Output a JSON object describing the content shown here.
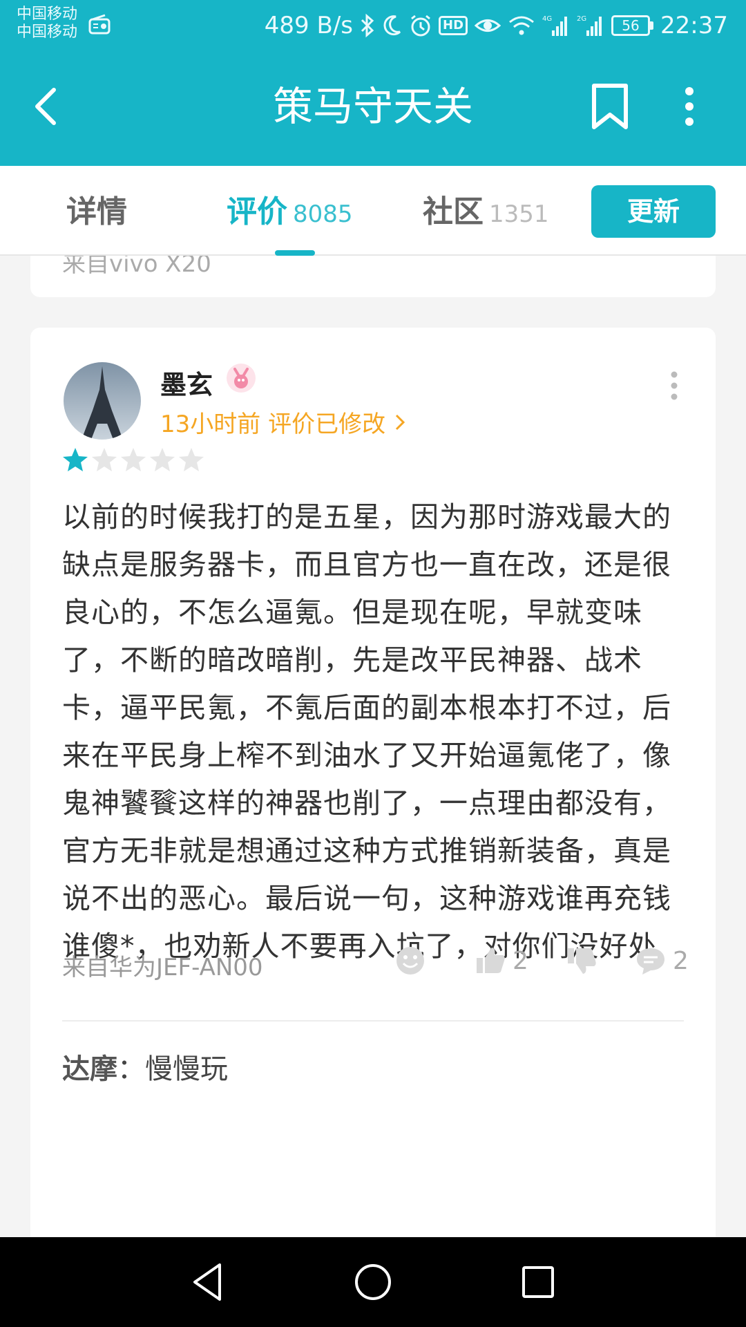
{
  "status_bar": {
    "carrier_1": "中国移动",
    "carrier_2": "中国移动",
    "speed": "489 B/s",
    "battery": "56",
    "time": "22:37"
  },
  "header": {
    "title": "策马守天关"
  },
  "tabs": [
    {
      "label": "详情",
      "count": ""
    },
    {
      "label": "评价",
      "count": "8085"
    },
    {
      "label": "社区",
      "count": "1351"
    }
  ],
  "update_button": "更新",
  "previous_card": {
    "from": "来自vivo X20"
  },
  "review": {
    "user": "墨玄",
    "meta": "13小时前 评价已修改",
    "rating": 1,
    "max_rating": 5,
    "text": "以前的时候我打的是五星，因为那时游戏最大的缺点是服务器卡，而且官方也一直在改，还是很良心的，不怎么逼氪。但是现在呢，早就变味了，不断的暗改暗削，先是改平民神器、战术卡，逼平民氪，不氪后面的副本根本打不过，后来在平民身上榨不到油水了又开始逼氪佬了，像鬼神饕餮这样的神器也削了，一点理由都没有，官方无非就是想通过这种方式推销新装备，真是说不出的恶心。最后说一句，这种游戏谁再充钱谁傻*，也劝新人不要再入坑了，对你们没好处",
    "device": "来自华为JEF-AN00",
    "likes": "2",
    "comments": "2",
    "reply_user": "达摩",
    "reply_text": "：慢慢玩"
  },
  "colors": {
    "accent": "#17b5c7",
    "meta": "#f5a623"
  }
}
